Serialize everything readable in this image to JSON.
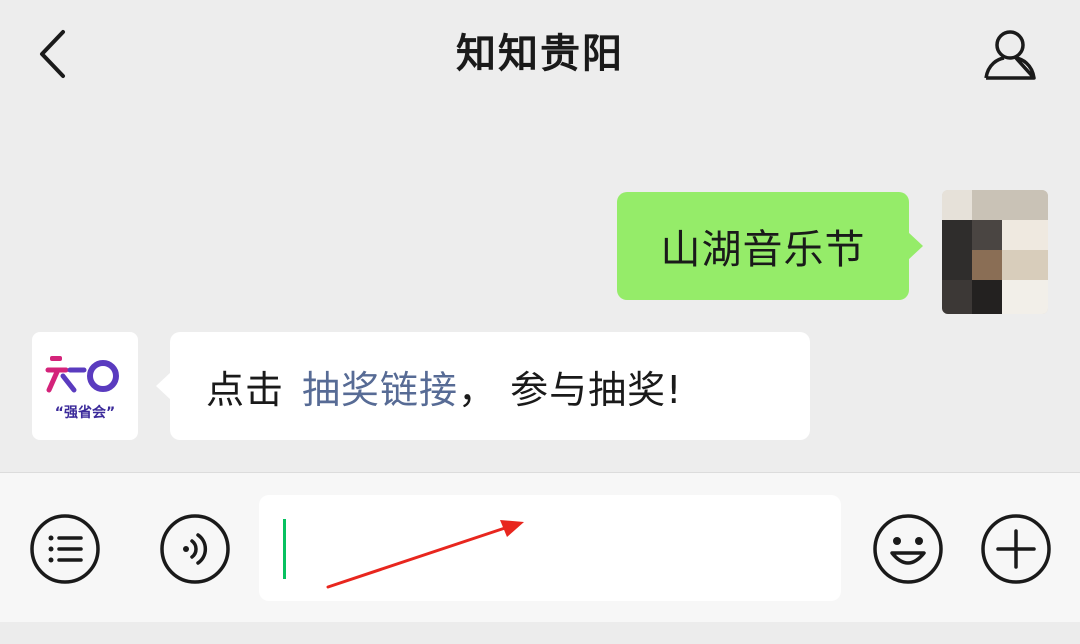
{
  "header": {
    "title": "知知贵阳",
    "back_icon": "chevron-left-icon",
    "profile_icon": "person-icon"
  },
  "messages": {
    "outgoing": {
      "text": "山湖音乐节",
      "bubble_color": "#95ec69"
    },
    "incoming": {
      "prefix": "点击",
      "link_text": "抽奖链接",
      "suffix": "，  参与抽奖!",
      "link_color": "#576b95",
      "sender_logo_text": "“强省会”"
    }
  },
  "input_bar": {
    "voice_list_icon": "menu-list-icon",
    "voice_icon": "voice-icon",
    "emoji_icon": "smiley-icon",
    "more_icon": "plus-icon",
    "input_value": "",
    "cursor_color": "#07c160"
  },
  "annotation": {
    "arrow_color": "#e8261e"
  }
}
